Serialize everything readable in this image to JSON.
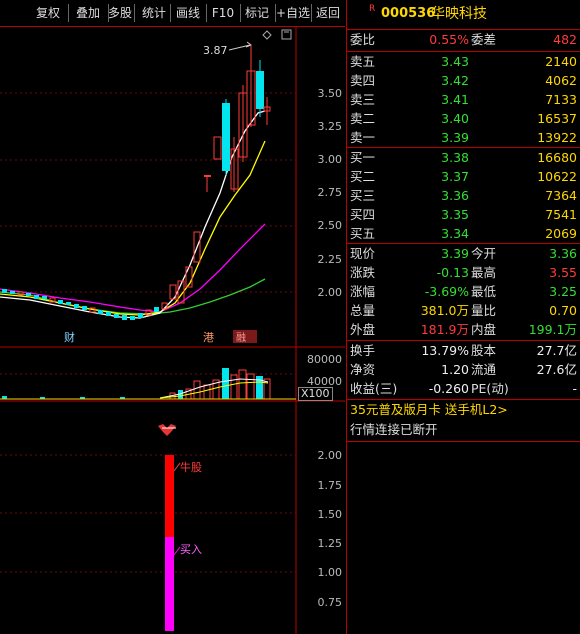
{
  "toolbar": {
    "buttons": [
      "复权",
      "叠加",
      "多股",
      "统计",
      "画线",
      "F10",
      "标记",
      "+自选",
      "返回"
    ]
  },
  "stock": {
    "badge": "R",
    "code": "000536",
    "name": "华映科技"
  },
  "main_chart": {
    "high_label": "3.87",
    "yticks": [
      "3.50",
      "3.25",
      "3.00",
      "2.75",
      "2.50",
      "2.25",
      "2.00"
    ],
    "markers": [
      "财",
      "港",
      "融"
    ]
  },
  "vol_chart": {
    "yticks": [
      "80000",
      "40000"
    ],
    "unit": "X100"
  },
  "ind_chart": {
    "yticks": [
      "2.00",
      "1.75",
      "1.50",
      "1.25",
      "1.00",
      "0.75"
    ],
    "label_bull": "牛股",
    "label_buy": "买入"
  },
  "quote": {
    "weibi_label": "委比",
    "weibi": "0.55%",
    "weicha_label": "委差",
    "weicha": "482",
    "sell": [
      {
        "label": "卖五",
        "price": "3.43",
        "vol": "2140"
      },
      {
        "label": "卖四",
        "price": "3.42",
        "vol": "4062"
      },
      {
        "label": "卖三",
        "price": "3.41",
        "vol": "7133"
      },
      {
        "label": "卖二",
        "price": "3.40",
        "vol": "16537"
      },
      {
        "label": "卖一",
        "price": "3.39",
        "vol": "13922"
      }
    ],
    "buy": [
      {
        "label": "买一",
        "price": "3.38",
        "vol": "16680"
      },
      {
        "label": "买二",
        "price": "3.37",
        "vol": "10622"
      },
      {
        "label": "买三",
        "price": "3.36",
        "vol": "7364"
      },
      {
        "label": "买四",
        "price": "3.35",
        "vol": "7541"
      },
      {
        "label": "买五",
        "price": "3.34",
        "vol": "2069"
      }
    ],
    "stats": [
      {
        "l1": "现价",
        "v1": "3.39",
        "l2": "今开",
        "v2": "3.36"
      },
      {
        "l1": "涨跌",
        "v1": "-0.13",
        "l2": "最高",
        "v2": "3.55"
      },
      {
        "l1": "涨幅",
        "v1": "-3.69%",
        "l2": "最低",
        "v2": "3.25"
      },
      {
        "l1": "总量",
        "v1": "381.0万",
        "l2": "量比",
        "v2": "0.70"
      },
      {
        "l1": "外盘",
        "v1": "181.9万",
        "l2": "内盘",
        "v2": "199.1万"
      }
    ],
    "finance": [
      {
        "l1": "换手",
        "v1": "13.79%",
        "l2": "股本",
        "v2": "27.7亿"
      },
      {
        "l1": "净资",
        "v1": "1.20",
        "l2": "流通",
        "v2": "27.6亿"
      },
      {
        "l1": "收益(三)",
        "v1": "-0.260",
        "l2": "PE(动)",
        "v2": "-"
      }
    ],
    "promo": "35元普及版月卡 送手机L2>",
    "status": "行情连接已断开"
  },
  "colors": {
    "up": "#ff3b3b",
    "down": "#33e033",
    "ma5": "#ffffff",
    "ma10": "#ffff00",
    "ma20": "#ff00ff",
    "ma60": "#33cc33",
    "bearish_candle": "#00e5ee",
    "signal_bull": "#ff0000",
    "signal_buy": "#ff00ff"
  }
}
